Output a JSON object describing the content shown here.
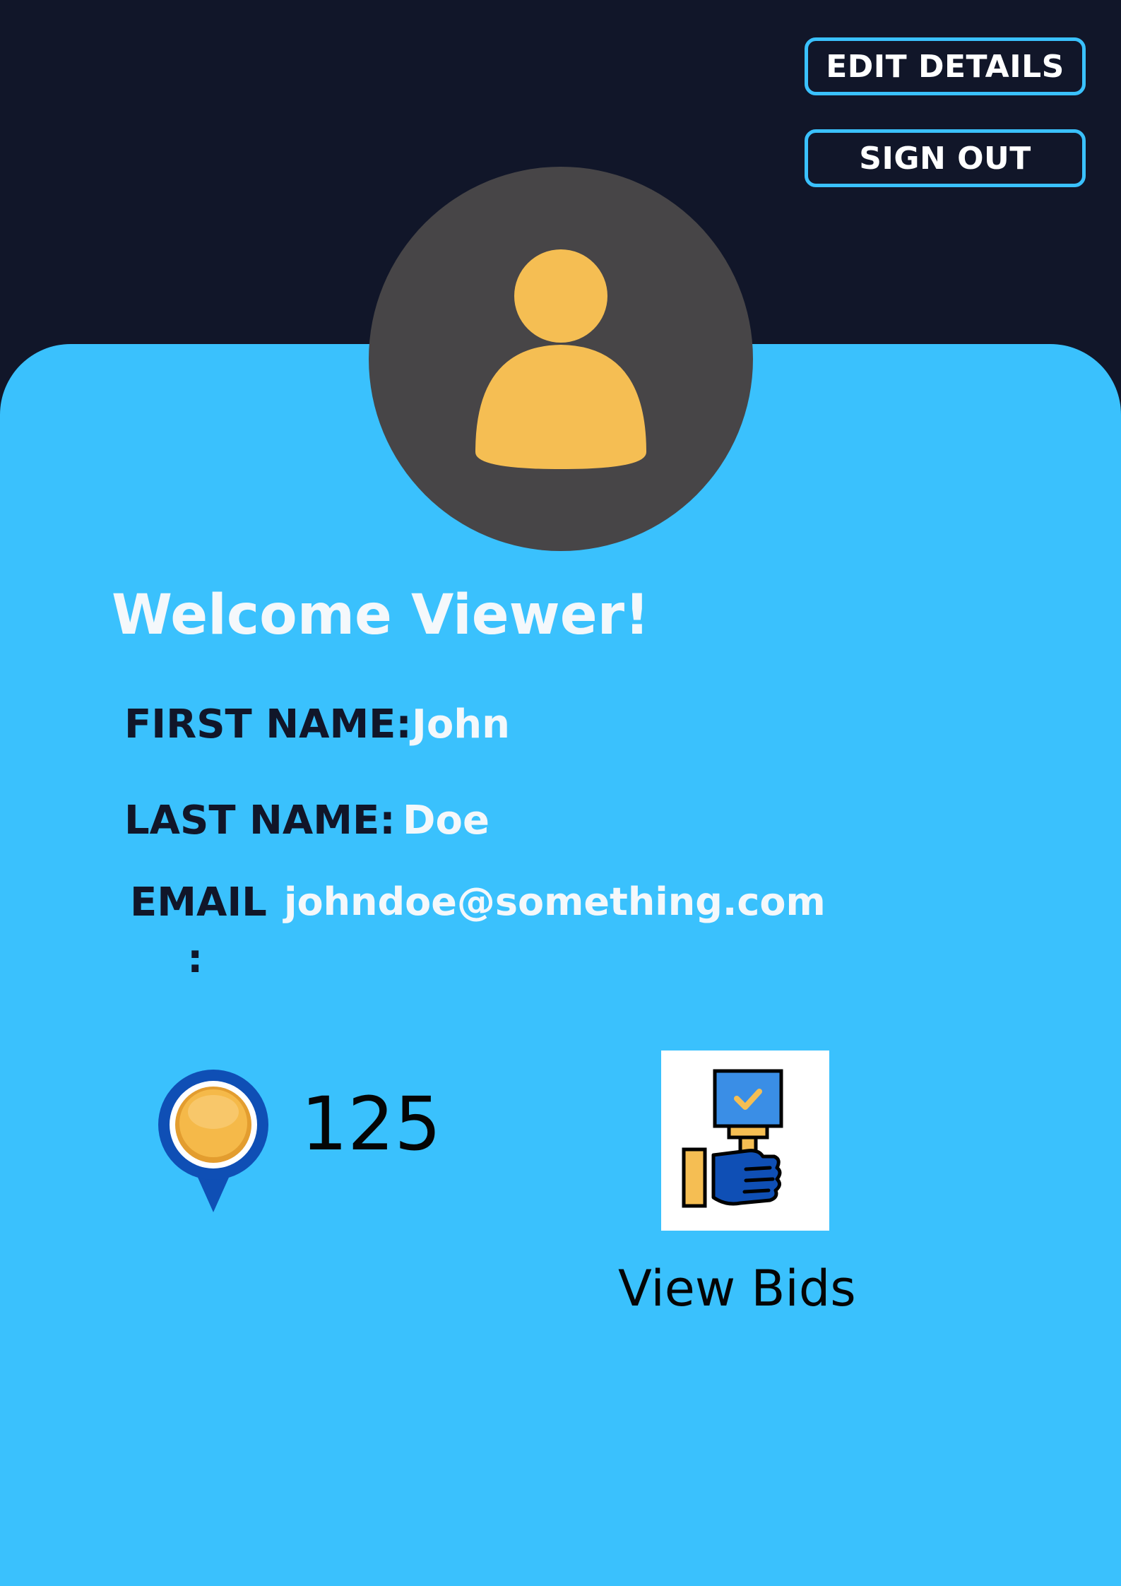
{
  "header": {
    "edit_details_label": "EDIT DETAILS",
    "sign_out_label": "SIGN OUT"
  },
  "avatar": {
    "icon": "user-icon"
  },
  "profile": {
    "welcome": "Welcome Viewer!",
    "first_name_label": "FIRST NAME:",
    "first_name_value": "John",
    "last_name_label": "LAST NAME:",
    "last_name_value": "Doe",
    "email_label": "EMAIL",
    "email_colon": ":",
    "email_value": "johndoe@something.com"
  },
  "coins": {
    "icon": "coin-location-icon",
    "count": "125"
  },
  "bids": {
    "icon": "bid-paddle-icon",
    "label": "View Bids"
  },
  "colors": {
    "header_bg": "#111629",
    "card_bg": "#3ac1fd",
    "avatar_bg": "#474547",
    "avatar_fg": "#f5be53",
    "button_border": "#3ac1fd",
    "label_text": "#111629",
    "value_text": "#f4f8fb"
  }
}
